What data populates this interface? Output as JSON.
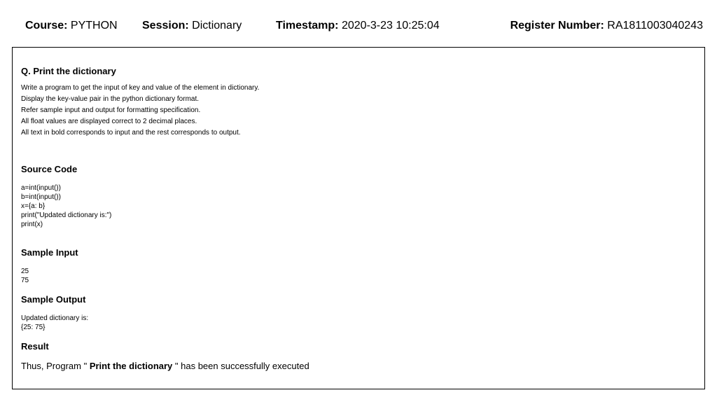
{
  "header": {
    "course_label": "Course:",
    "course": "PYTHON",
    "session_label": "Session:",
    "session": "Dictionary",
    "timestamp_label": "Timestamp:",
    "timestamp": "2020-3-23 10:25:04",
    "register_label": "Register Number:",
    "register": "RA1811003040243"
  },
  "question": {
    "title": "Q. Print the dictionary",
    "lines": [
      "Write a program to get the input of key and value of the element in dictionary.",
      "Display the key-value pair in the python dictionary format.",
      "Refer sample input and output for formatting specification.",
      "All float values are displayed correct to 2 decimal places.",
      "All text in bold corresponds to input and the rest corresponds to output."
    ]
  },
  "source": {
    "title": "Source Code",
    "lines": [
      "a=int(input())",
      "b=int(input())",
      "x={a: b}",
      "print(\"Updated dictionary is:\")",
      "print(x)"
    ]
  },
  "sample_input": {
    "title": "Sample Input",
    "lines": [
      "25",
      "75"
    ]
  },
  "sample_output": {
    "title": "Sample Output",
    "lines": [
      "Updated dictionary is:",
      "{25: 75}"
    ]
  },
  "result": {
    "title": "Result",
    "prefix": "Thus, Program \" ",
    "name": "Print the dictionary",
    "suffix": " \" has been successfully executed"
  }
}
